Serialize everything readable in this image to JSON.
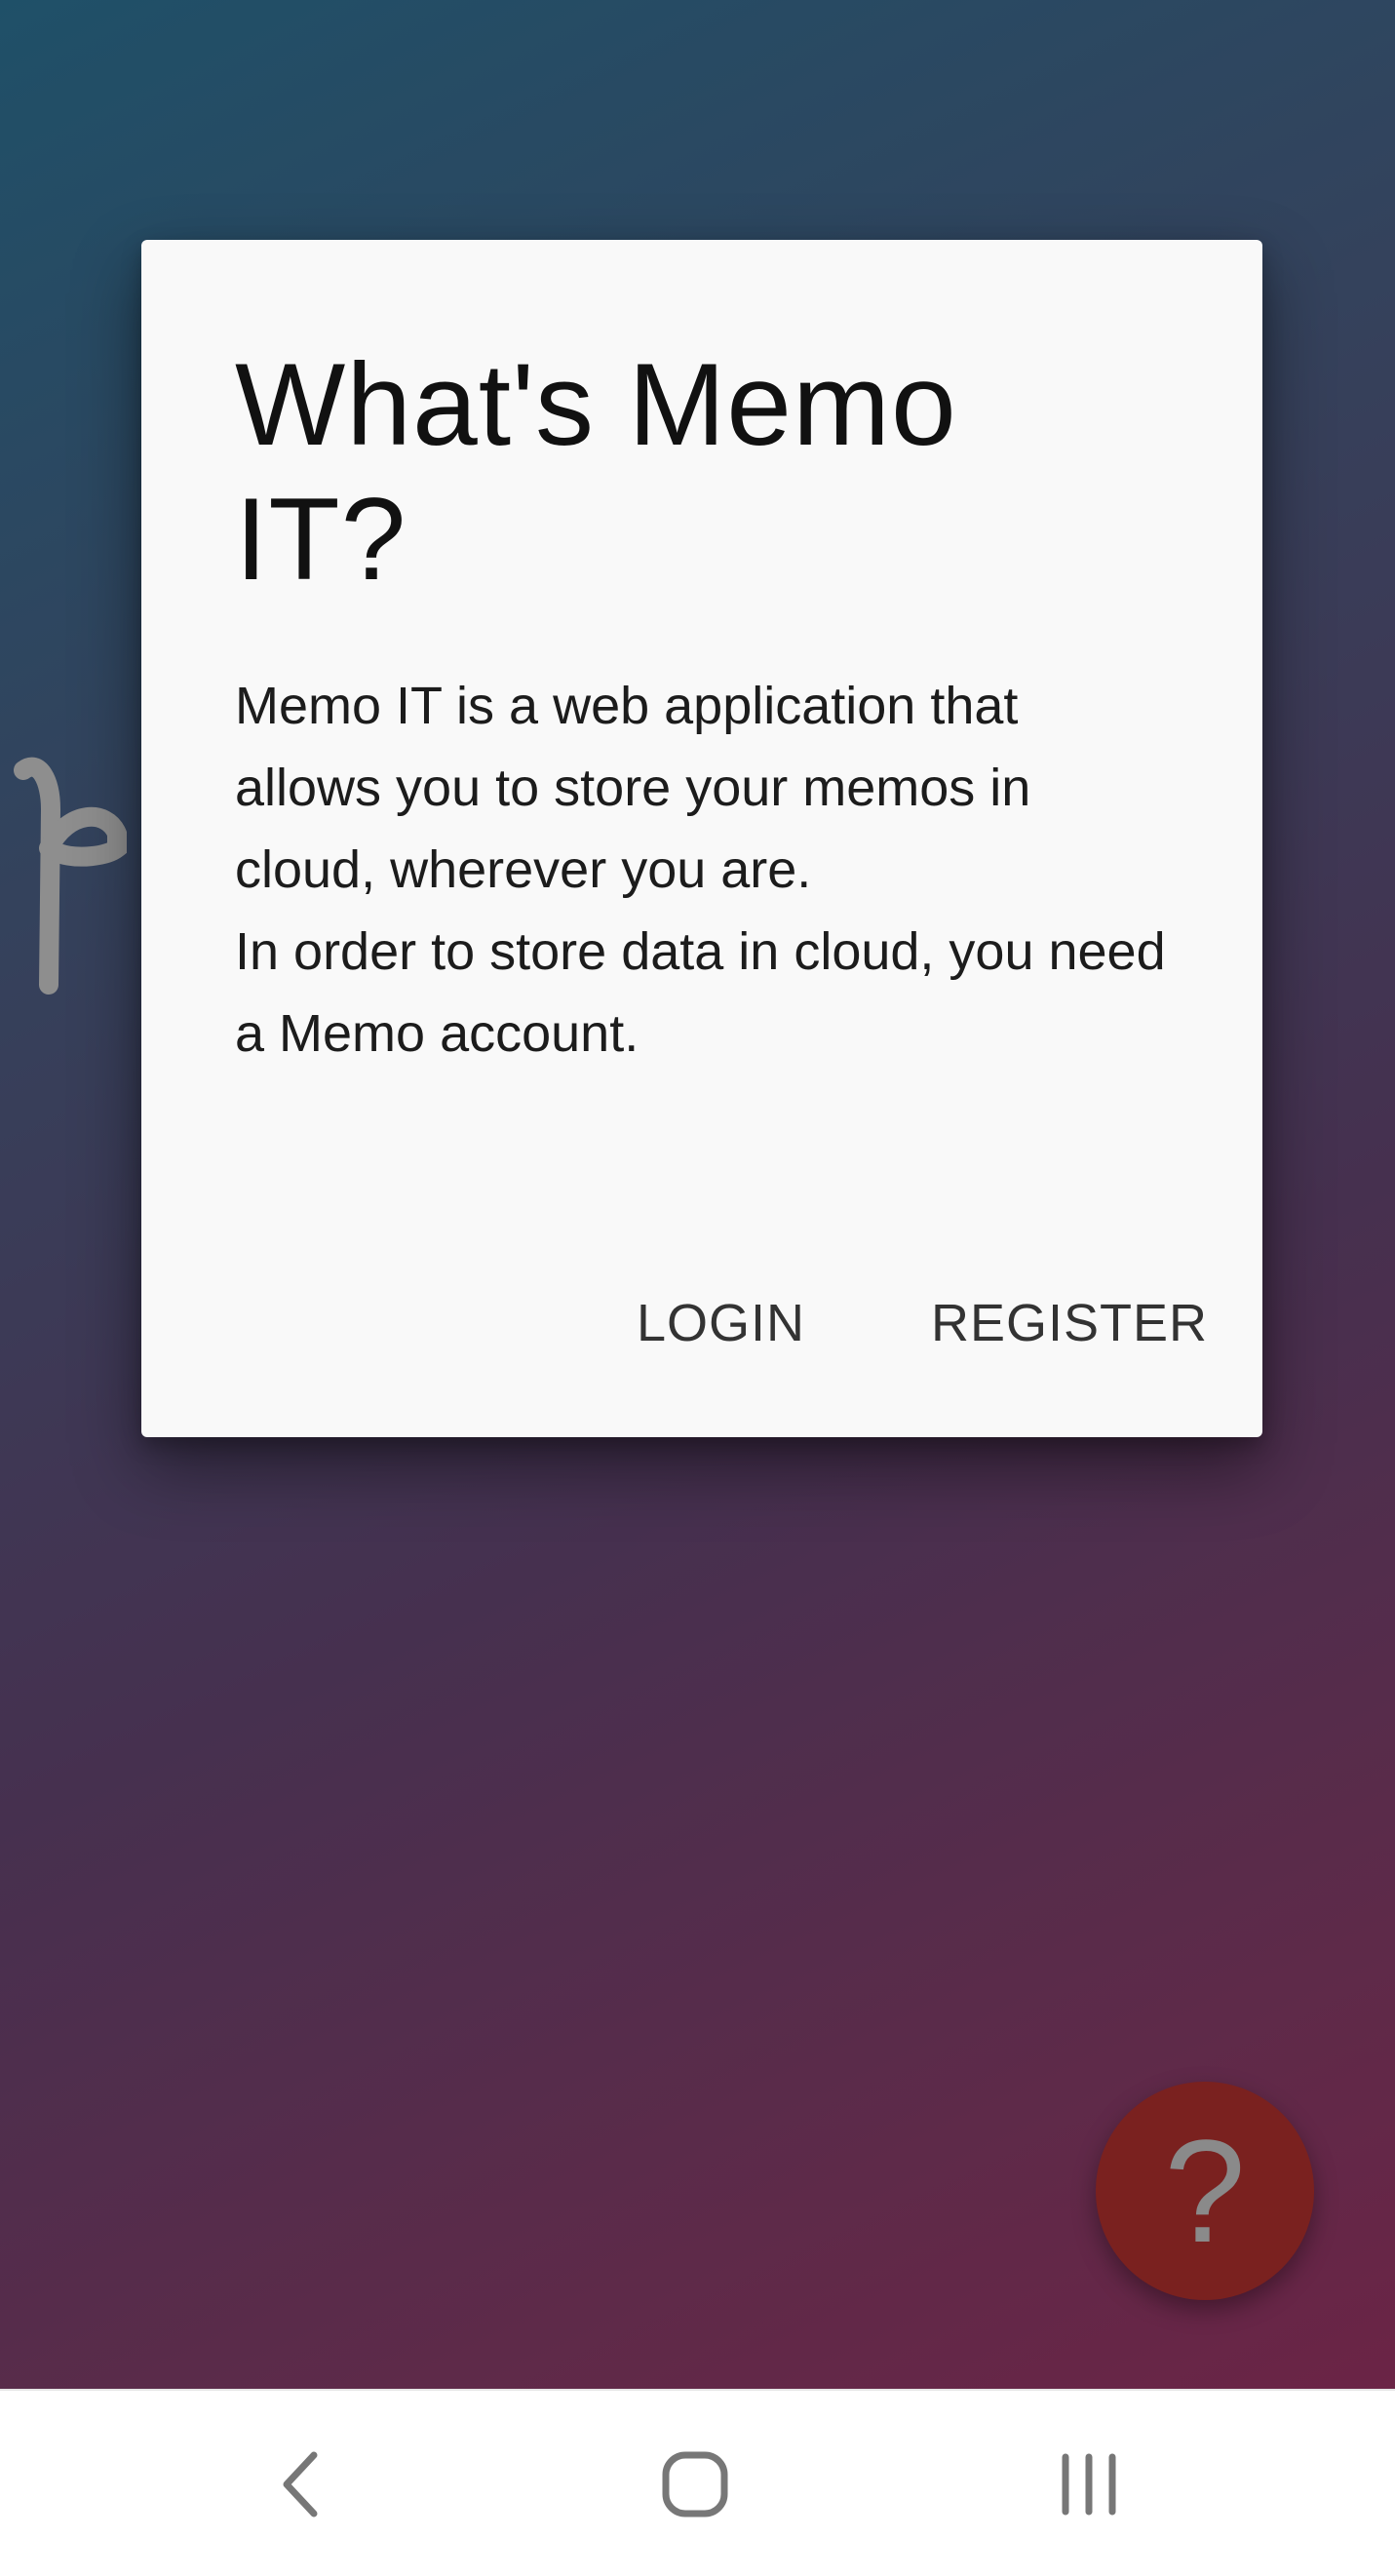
{
  "dialog": {
    "title": "What's Memo IT?",
    "body_line_1": "Memo IT is a web application that allows you to store your memos in cloud, wherever you are.",
    "body_line_2": "In order to store data in cloud, you need a Memo account.",
    "login_label": "LOGIN",
    "register_label": "REGISTER"
  },
  "fab": {
    "icon": "help-question-icon",
    "glyph": "?"
  },
  "navigation_bar": {
    "back_icon": "back-chevron-icon",
    "home_icon": "home-square-icon",
    "recents_icon": "recents-bars-icon"
  },
  "colors": {
    "background_top": "#1f5068",
    "background_bottom": "#6b2446",
    "dialog_bg": "#f9f9f9",
    "fab_bg": "#7a211f"
  }
}
